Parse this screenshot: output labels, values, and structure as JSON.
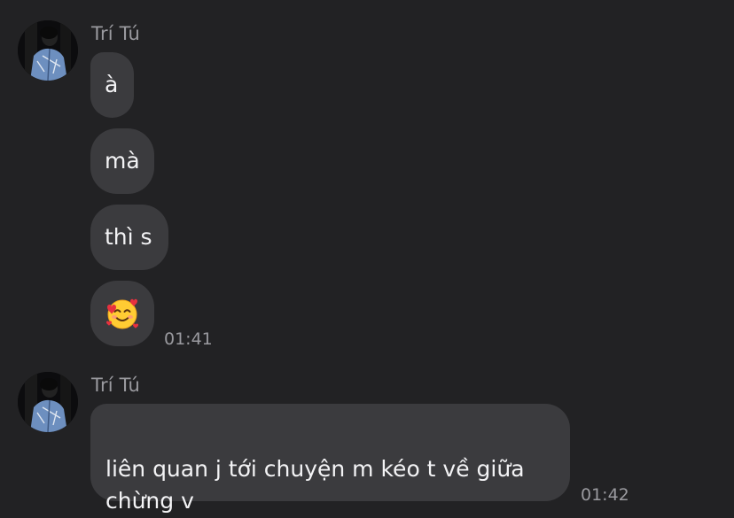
{
  "messages": [
    {
      "sender": "Trí Tú",
      "avatar": "user-avatar-photo",
      "bubbles": [
        "à",
        "mà",
        "thì s"
      ],
      "reaction_emoji": "smiling-face-with-hearts-emoji",
      "time": "01:41"
    },
    {
      "sender": "Trí Tú",
      "avatar": "user-avatar-photo",
      "bubbles": [
        "liên quan j tới chuyện m kéo t về giữa\nchừng v"
      ],
      "time": "01:42"
    }
  ],
  "colors": {
    "background": "#222224",
    "bubble": "#3b3b3e",
    "text": "#f3f3f5",
    "muted": "#9a9a9f"
  }
}
